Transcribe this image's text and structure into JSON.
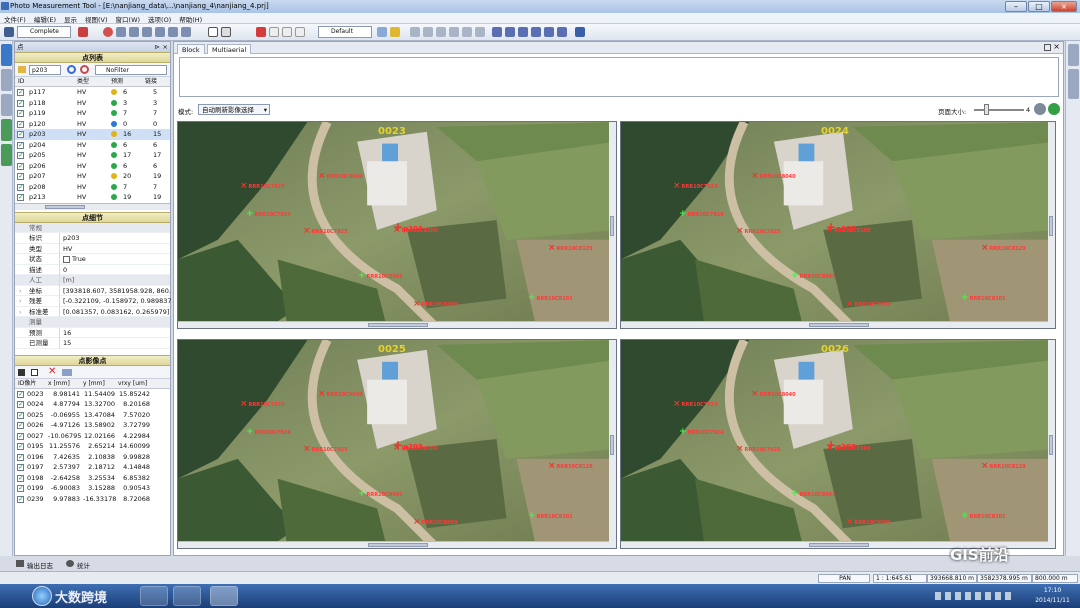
{
  "app": {
    "title": "Photo Measurement Tool - [E:\\nanjiang_data\\...\\nanjiang_4\\nanjiang_4.prj]"
  },
  "menu": [
    "文件(F)",
    "编辑(E)",
    "显示",
    "视图(V)",
    "窗口(W)",
    "选项(O)",
    "帮助(H)"
  ],
  "toolbar": {
    "mode_combo": "Complete",
    "style_combo": "Default"
  },
  "left_icons": [
    "点",
    "影像",
    "测量",
    "测段",
    "日志"
  ],
  "right_icons": [
    "属性",
    "工具箱"
  ],
  "panel": {
    "title": "点",
    "points_header": "点列表",
    "search_value": "p203",
    "filter_label": "NoFilter",
    "columns": [
      "ID",
      "类型",
      "预测",
      "链接"
    ],
    "rows": [
      {
        "id": "p117",
        "type": "HV",
        "pred": "6",
        "link": "5",
        "color": "#e2b21a"
      },
      {
        "id": "p118",
        "type": "HV",
        "pred": "3",
        "link": "3",
        "color": "#2aa84a"
      },
      {
        "id": "p119",
        "type": "HV",
        "pred": "7",
        "link": "7",
        "color": "#2aa84a"
      },
      {
        "id": "p120",
        "type": "HV",
        "pred": "0",
        "link": "0",
        "color": "#2a78d8"
      },
      {
        "id": "p203",
        "type": "HV",
        "pred": "16",
        "link": "15",
        "color": "#e2b21a"
      },
      {
        "id": "p204",
        "type": "HV",
        "pred": "6",
        "link": "6",
        "color": "#2aa84a"
      },
      {
        "id": "p205",
        "type": "HV",
        "pred": "17",
        "link": "17",
        "color": "#2aa84a"
      },
      {
        "id": "p206",
        "type": "HV",
        "pred": "6",
        "link": "6",
        "color": "#2aa84a"
      },
      {
        "id": "p207",
        "type": "HV",
        "pred": "20",
        "link": "19",
        "color": "#e2b21a"
      },
      {
        "id": "p208",
        "type": "HV",
        "pred": "7",
        "link": "7",
        "color": "#2aa84a"
      },
      {
        "id": "p213",
        "type": "HV",
        "pred": "19",
        "link": "19",
        "color": "#2aa84a"
      }
    ],
    "selected_row": 4,
    "detail_header": "点细节",
    "props": [
      {
        "cat": true,
        "k": "常规",
        "v": ""
      },
      {
        "k": "标识",
        "v": "p203"
      },
      {
        "k": "类型",
        "v": "HV"
      },
      {
        "k": "状态",
        "v": "True"
      },
      {
        "k": "描述",
        "v": "0"
      },
      {
        "cat": true,
        "k": "人工",
        "v": "[m]"
      },
      {
        "k": "坐标",
        "v": "[393818.607, 3581958.928, 860...."
      },
      {
        "k": "残差",
        "v": "[-0.322109, -0.158972, 0.989837]"
      },
      {
        "k": "标准差",
        "v": "[0.081357, 0.083162, 0.265979]"
      },
      {
        "cat": true,
        "k": "测量",
        "v": ""
      },
      {
        "k": "预测",
        "v": "16"
      },
      {
        "k": "已测量",
        "v": "15"
      }
    ],
    "imgpts_header": "点影像点",
    "imgcols": [
      "ID像片",
      "x [mm]",
      "y [mm]",
      "vrxy [um]"
    ],
    "imgrows": [
      [
        "0023",
        "8.98141",
        "11.54409",
        "15.85242"
      ],
      [
        "0024",
        "4.87794",
        "13.32700",
        "8.20168"
      ],
      [
        "0025",
        "-0.06955",
        "13.47084",
        "7.57020"
      ],
      [
        "0026",
        "-4.97126",
        "13.58902",
        "3.72799"
      ],
      [
        "0027",
        "-10.06795",
        "12.02166",
        "4.22984"
      ],
      [
        "0195",
        "11.25576",
        "2.65214",
        "14.60099"
      ],
      [
        "0196",
        "7.42635",
        "2.10838",
        "9.99828"
      ],
      [
        "0197",
        "2.57397",
        "2.18712",
        "4.14848"
      ],
      [
        "0198",
        "-2.64258",
        "3.25534",
        "6.85382"
      ],
      [
        "0199",
        "-6.90083",
        "3.15288",
        "0.90543"
      ],
      [
        "0239",
        "9.97883",
        "-16.33178",
        "8.72068"
      ]
    ]
  },
  "work": {
    "tabs": [
      "Block",
      "Multiaerial"
    ],
    "mode_label": "模式:",
    "mode_value": "自动刷新影像选择",
    "page_size_label": "页面大小:",
    "page_size_value": "4",
    "images": [
      {
        "label": "0023"
      },
      {
        "label": "0024"
      },
      {
        "label": "0025"
      },
      {
        "label": "0026"
      }
    ],
    "point_label": "p203",
    "tie_labels": [
      "RRR10C7923",
      "RRR10C7924",
      "RRR10C7925",
      "RRR10C8040",
      "RRR10C8041",
      "RRR10C8099",
      "RRR10C8100",
      "RRR10C8101",
      "RRR10C8129"
    ]
  },
  "bottom": {
    "tabs": [
      "输出日志",
      "统计"
    ]
  },
  "status": {
    "pan": "PAN",
    "scale": "1 : 1:645.61",
    "x": "393668.810 m",
    "y": "3582378.995 m",
    "z": "800.000 m"
  },
  "taskbar": {
    "time": "17:10",
    "date": "2014/11/11"
  },
  "watermarks": {
    "left": "大数跨境",
    "right": "GIS前沿"
  }
}
